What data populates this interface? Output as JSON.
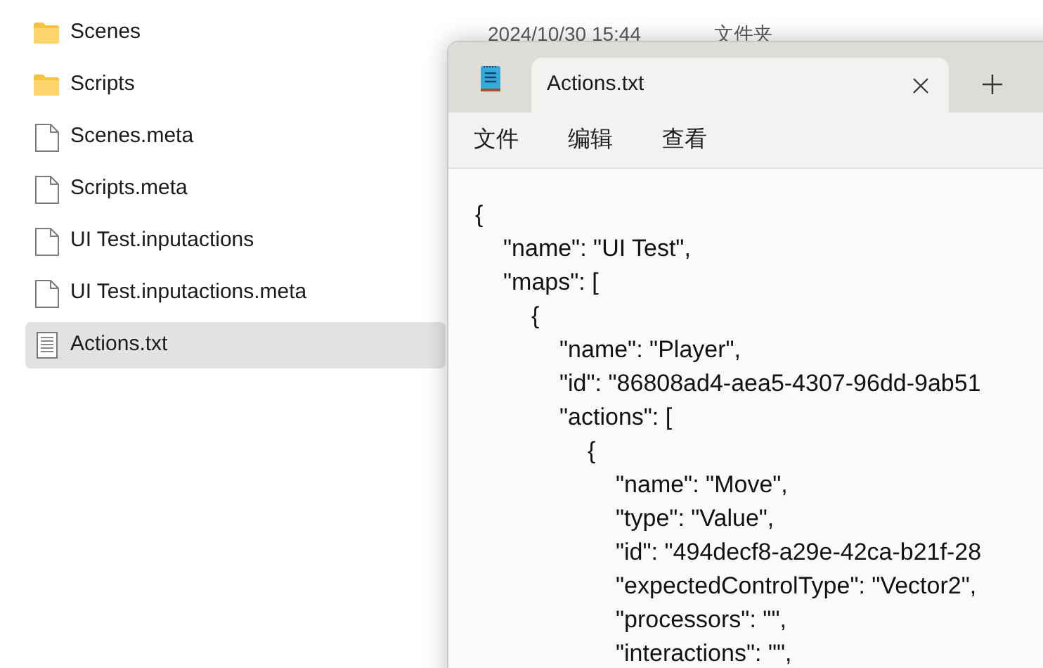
{
  "explorer": {
    "files": [
      {
        "name": "Scenes",
        "kind": "folder",
        "selected": false
      },
      {
        "name": "Scripts",
        "kind": "folder",
        "selected": false
      },
      {
        "name": "Scenes.meta",
        "kind": "file",
        "selected": false
      },
      {
        "name": "Scripts.meta",
        "kind": "file",
        "selected": false
      },
      {
        "name": "UI Test.inputactions",
        "kind": "file",
        "selected": false
      },
      {
        "name": "UI Test.inputactions.meta",
        "kind": "file",
        "selected": false
      },
      {
        "name": "Actions.txt",
        "kind": "text",
        "selected": true
      }
    ],
    "first_row_details": {
      "modified": "2024/10/30 15:44",
      "type": "文件夹"
    }
  },
  "notepad": {
    "tab": {
      "title": "Actions.txt",
      "selected": true
    },
    "menu": [
      "文件",
      "编辑",
      "查看"
    ],
    "lines": [
      {
        "text": "{",
        "children": [
          {
            "text": "\"name\": \"UI Test\","
          },
          {
            "text": "\"maps\": [",
            "children": [
              {
                "text": "{",
                "children": [
                  {
                    "text": "\"name\": \"Player\","
                  },
                  {
                    "text": "\"id\": \"86808ad4-aea5-4307-96dd-9ab51"
                  },
                  {
                    "text": "\"actions\": [",
                    "children": [
                      {
                        "text": "{",
                        "children": [
                          {
                            "text": "\"name\": \"Move\","
                          },
                          {
                            "text": "\"type\": \"Value\","
                          },
                          {
                            "text": "\"id\": \"494decf8-a29e-42ca-b21f-28"
                          },
                          {
                            "text": "\"expectedControlType\": \"Vector2\","
                          },
                          {
                            "text": "\"processors\": \"\","
                          },
                          {
                            "text": "\"interactions\": \"\","
                          }
                        ]
                      }
                    ]
                  }
                ]
              }
            ]
          }
        ]
      }
    ]
  }
}
